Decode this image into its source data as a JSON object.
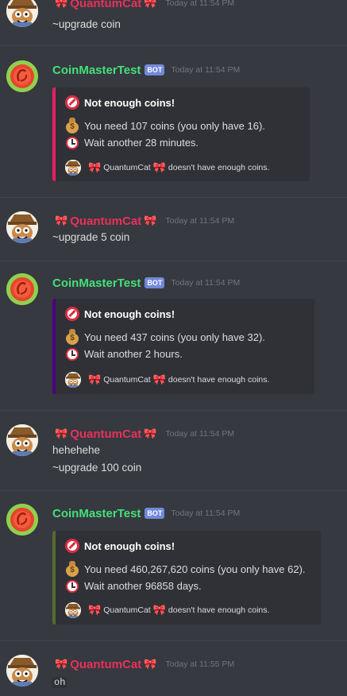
{
  "colors": {
    "user": "#e8315b",
    "bot": "#43e07a",
    "embed1": "#e91e63",
    "embed2": "#4b0082",
    "embed3": "#556b2f",
    "background": "#36393f"
  },
  "messages": [
    {
      "author": "QuantumCat",
      "timestamp": "Today at 11:54 PM",
      "lines": [
        "~upgrade coin"
      ]
    },
    {
      "author": "CoinMasterTest",
      "badge": "BOT",
      "timestamp": "Today at 11:54 PM",
      "embed": {
        "title": "Not enough coins!",
        "line1": "You need 107 coins (you only have 16).",
        "line2": "Wait another 28 minutes.",
        "footer_user": "QuantumCat",
        "footer_text": "doesn't have enough coins."
      }
    },
    {
      "author": "QuantumCat",
      "timestamp": "Today at 11:54 PM",
      "lines": [
        "~upgrade 5 coin"
      ]
    },
    {
      "author": "CoinMasterTest",
      "badge": "BOT",
      "timestamp": "Today at 11:54 PM",
      "embed": {
        "title": "Not enough coins!",
        "line1": "You need 437 coins (you only have 32).",
        "line2": "Wait another 2 hours.",
        "footer_user": "QuantumCat",
        "footer_text": "doesn't have enough coins."
      }
    },
    {
      "author": "QuantumCat",
      "timestamp": "Today at 11:54 PM",
      "lines": [
        "hehehehe",
        "~upgrade 100 coin"
      ]
    },
    {
      "author": "CoinMasterTest",
      "badge": "BOT",
      "timestamp": "Today at 11:54 PM",
      "embed": {
        "title": "Not enough coins!",
        "line1": "You need 460,267,620 coins (you only have 62).",
        "line2": "Wait another 96858 days.",
        "footer_user": "QuantumCat",
        "footer_text": "doesn't have enough coins."
      }
    },
    {
      "author": "QuantumCat",
      "timestamp": "Today at 11:55 PM",
      "lines": [
        "oh"
      ]
    }
  ]
}
